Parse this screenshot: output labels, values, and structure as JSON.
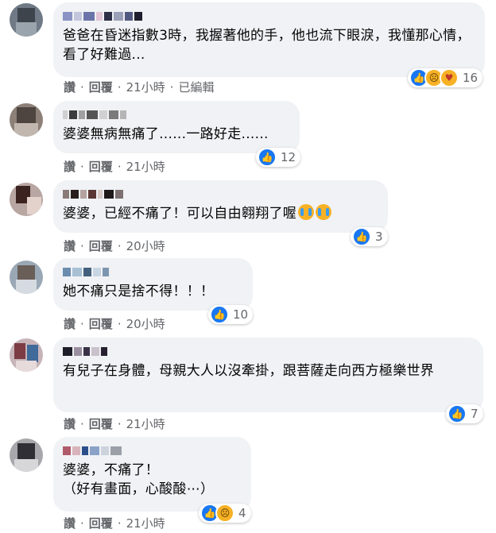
{
  "actions": {
    "like": "讚",
    "reply": "回覆",
    "dot": "·",
    "edited": "已編輯"
  },
  "comments": [
    {
      "text": "爸爸在昏迷指數3時，我握著他的手，他也流下眼淚，我懂那心情，看了好難過...",
      "time": "21小時",
      "reactions": [
        "like",
        "sad",
        "care"
      ],
      "count": "16"
    },
    {
      "text": "婆婆無病無痛了......一路好走......",
      "time": "21小時",
      "reactions": [
        "like"
      ],
      "count": "12"
    },
    {
      "text": "婆婆，已經不痛了！可以自由翱翔了喔",
      "time": "20小時",
      "reactions": [
        "like"
      ],
      "count": "3"
    },
    {
      "text": "她不痛只是捨不得！！！",
      "time": "20小時",
      "reactions": [
        "like"
      ],
      "count": "10"
    },
    {
      "text": "有兒子在身體，母親大人以沒牽掛，跟菩薩走向西方極樂世界",
      "time": "21小時",
      "reactions": [
        "like"
      ],
      "count": "7"
    },
    {
      "text": "婆婆，不痛了！\n（好有畫面，心酸酸⋯）",
      "time": "21小時",
      "reactions": [
        "like",
        "sad"
      ],
      "count": "4"
    }
  ],
  "colors": {
    "like": "#1877f2",
    "bubble": "#f0f2f5",
    "meta": "#65676b"
  },
  "icons": {
    "like": "like-thumb-icon",
    "sad": "sad-face-icon",
    "care": "care-face-icon"
  }
}
